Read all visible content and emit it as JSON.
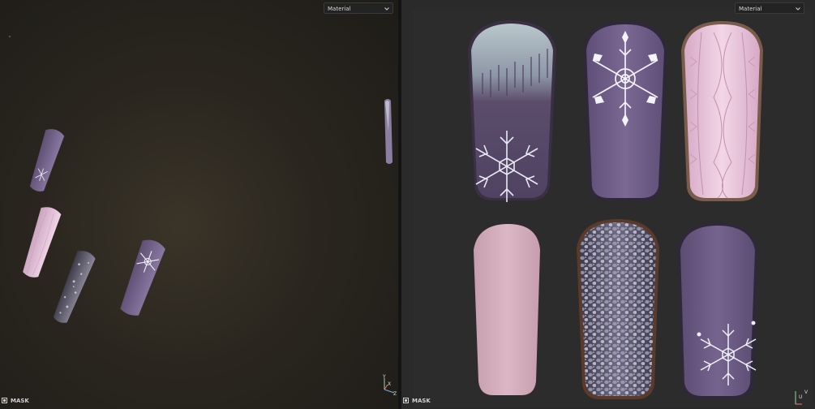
{
  "left_viewport": {
    "material_dropdown": {
      "selected": "Material"
    },
    "mask_label": "MASK",
    "axis_gizmo": {
      "labels": [
        "Y",
        "X",
        "Z"
      ]
    }
  },
  "right_viewport": {
    "material_dropdown": {
      "selected": "Material"
    },
    "mask_label": "MASK",
    "axis_gizmo": {
      "labels": [
        "V",
        "U"
      ]
    }
  },
  "nails": [
    {
      "name": "gradient-snowflake",
      "base": "#5b4c6b",
      "tip": "#b7c4c8",
      "pattern": "snowflake-corner"
    },
    {
      "name": "snowflake-center",
      "base": "#6e5c84",
      "pattern": "snowflake-top"
    },
    {
      "name": "cable-knit-pink",
      "base": "#e3bfd6",
      "pattern": "knit"
    },
    {
      "name": "plain-pink",
      "base": "#d6b0bf",
      "pattern": "none"
    },
    {
      "name": "glitter-silver",
      "base": "#4a4658",
      "pattern": "glitter"
    },
    {
      "name": "snowflake-bottom",
      "base": "#6a5a80",
      "pattern": "snowflake-bottom"
    }
  ],
  "colors": {
    "panel_bg": "#2a2a2a",
    "left_bg": "#2a261f",
    "accent_pink": "#e3bfd6",
    "accent_purple": "#6e5c84"
  }
}
